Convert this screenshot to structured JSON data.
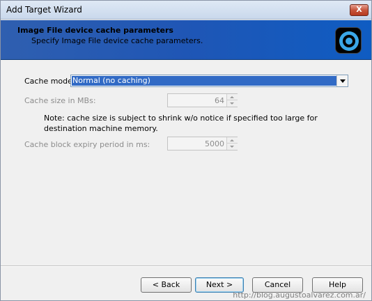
{
  "window": {
    "title": "Add Target Wizard",
    "close_glyph": "X"
  },
  "banner": {
    "title": "Image File device cache parameters",
    "subtitle": "Specify Image File device cache parameters.",
    "icon": "target-disc-icon"
  },
  "form": {
    "cache_mode_label": "Cache mode",
    "cache_mode_value": "Normal (no caching)",
    "cache_size_label": "Cache size in MBs:",
    "cache_size_value": "64",
    "note": "Note: cache size is subject to shrink w/o notice if specified too large for destination machine memory.",
    "expiry_label": "Cache block expiry period in ms:",
    "expiry_value": "5000"
  },
  "buttons": {
    "back": "< Back",
    "next": "Next >",
    "cancel": "Cancel",
    "help": "Help"
  },
  "watermark": "http://blog.augustoalvarez.com.ar/",
  "colors": {
    "banner": "#1f56b5",
    "selection": "#316ac5"
  }
}
